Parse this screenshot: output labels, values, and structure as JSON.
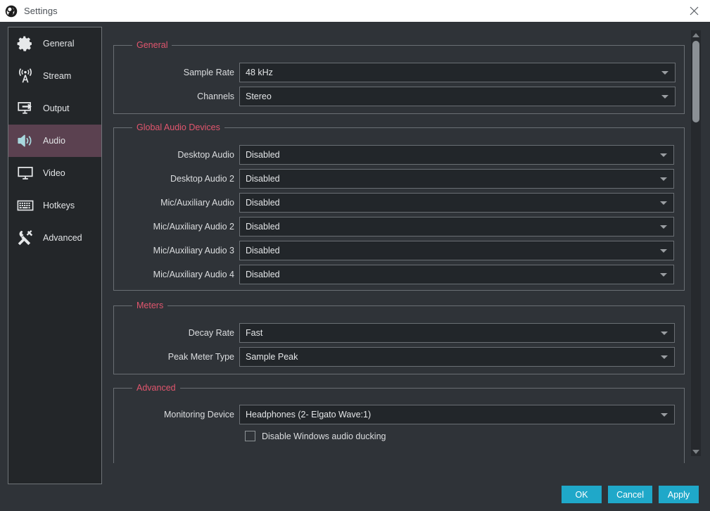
{
  "window": {
    "title": "Settings",
    "logo_icon": "obs-logo-icon",
    "close_icon": "close-icon"
  },
  "sidebar": {
    "items": [
      {
        "label": "General",
        "icon": "gear-icon",
        "selected": false
      },
      {
        "label": "Stream",
        "icon": "broadcast-icon",
        "selected": false
      },
      {
        "label": "Output",
        "icon": "output-icon",
        "selected": false
      },
      {
        "label": "Audio",
        "icon": "speaker-icon",
        "selected": true
      },
      {
        "label": "Video",
        "icon": "monitor-icon",
        "selected": false
      },
      {
        "label": "Hotkeys",
        "icon": "keyboard-icon",
        "selected": false
      },
      {
        "label": "Advanced",
        "icon": "tools-icon",
        "selected": false
      }
    ]
  },
  "groups": {
    "general": {
      "title": "General",
      "rows": [
        {
          "label": "Sample Rate",
          "value": "48 kHz"
        },
        {
          "label": "Channels",
          "value": "Stereo"
        }
      ]
    },
    "global_audio_devices": {
      "title": "Global Audio Devices",
      "rows": [
        {
          "label": "Desktop Audio",
          "value": "Disabled"
        },
        {
          "label": "Desktop Audio 2",
          "value": "Disabled"
        },
        {
          "label": "Mic/Auxiliary Audio",
          "value": "Disabled"
        },
        {
          "label": "Mic/Auxiliary Audio 2",
          "value": "Disabled"
        },
        {
          "label": "Mic/Auxiliary Audio 3",
          "value": "Disabled"
        },
        {
          "label": "Mic/Auxiliary Audio 4",
          "value": "Disabled"
        }
      ]
    },
    "meters": {
      "title": "Meters",
      "rows": [
        {
          "label": "Decay Rate",
          "value": "Fast"
        },
        {
          "label": "Peak Meter Type",
          "value": "Sample Peak"
        }
      ]
    },
    "advanced": {
      "title": "Advanced",
      "rows": [
        {
          "label": "Monitoring Device",
          "value": "Headphones (2- Elgato Wave:1)"
        }
      ],
      "checkbox": {
        "label": "Disable Windows audio ducking",
        "checked": false
      }
    }
  },
  "scrollbar": {
    "up_icon": "scroll-up-arrow-icon",
    "down_icon": "scroll-down-arrow-icon"
  },
  "footer": {
    "ok_label": "OK",
    "cancel_label": "Cancel",
    "apply_label": "Apply"
  },
  "colors": {
    "accent_button": "#1fa8c9",
    "group_title": "#e2566e",
    "selected_nav": "#5b4150",
    "window_bg": "#2f3338",
    "sidebar_bg": "#232629"
  }
}
